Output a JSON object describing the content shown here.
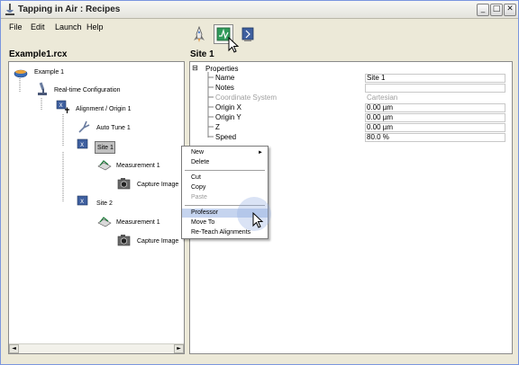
{
  "window": {
    "title": "Tapping in Air : Recipes",
    "minimize": "_",
    "maximize": "□",
    "close": "✕"
  },
  "menu": [
    "File",
    "Edit",
    "Launch",
    "Help"
  ],
  "toolbar": {
    "buttons": [
      "launch-icon",
      "recipe-icon",
      "alignment-icon"
    ]
  },
  "left_panel": {
    "title": "Example1.rcx"
  },
  "tree": [
    {
      "label": "Example 1",
      "icon": "recipe-bowl-icon"
    },
    {
      "label": "Real-time Configuration",
      "icon": "microscope-icon"
    },
    {
      "label": "Alignment / Origin 1",
      "icon": "alignment-icon"
    },
    {
      "label": "Auto Tune 1",
      "icon": "tuning-fork-icon"
    },
    {
      "label": "Site 1",
      "icon": "site-icon"
    },
    {
      "label": "Measurement 1",
      "icon": "measurement-icon"
    },
    {
      "label": "Capture Image",
      "icon": "camera-icon"
    },
    {
      "label": "Site 2",
      "icon": "site-icon"
    },
    {
      "label": "Measurement 1",
      "icon": "measurement-icon"
    },
    {
      "label": "Capture Image",
      "icon": "camera-icon"
    }
  ],
  "right_panel": {
    "title": "Site 1",
    "group": "Properties",
    "expander": "⊟"
  },
  "properties": [
    {
      "name": "Name",
      "value": "Site 1",
      "disabled": false
    },
    {
      "name": "Notes",
      "value": "",
      "disabled": false
    },
    {
      "name": "Coordinate System",
      "value": "Cartesian",
      "disabled": true
    },
    {
      "name": "Origin X",
      "value": "0.00 µm",
      "disabled": false
    },
    {
      "name": "Origin Y",
      "value": "0.00 µm",
      "disabled": false
    },
    {
      "name": "Z",
      "value": "0.00 µm",
      "disabled": false
    },
    {
      "name": "Speed",
      "value": "80.0 %",
      "disabled": false
    }
  ],
  "context_menu": {
    "items": [
      {
        "label": "New",
        "submenu": "►"
      },
      {
        "label": "Delete"
      },
      {
        "label": "Cut"
      },
      {
        "label": "Copy"
      },
      {
        "label": "Paste",
        "disabled": true
      },
      {
        "label": "Professor",
        "highlighted": true
      },
      {
        "label": "Move To"
      },
      {
        "label": "Re-Teach Alignments"
      }
    ]
  },
  "colors": {
    "selection": "#c5d4ef",
    "title_bar": "#ece9d8",
    "highlight_circle": "#b8c9ec"
  }
}
